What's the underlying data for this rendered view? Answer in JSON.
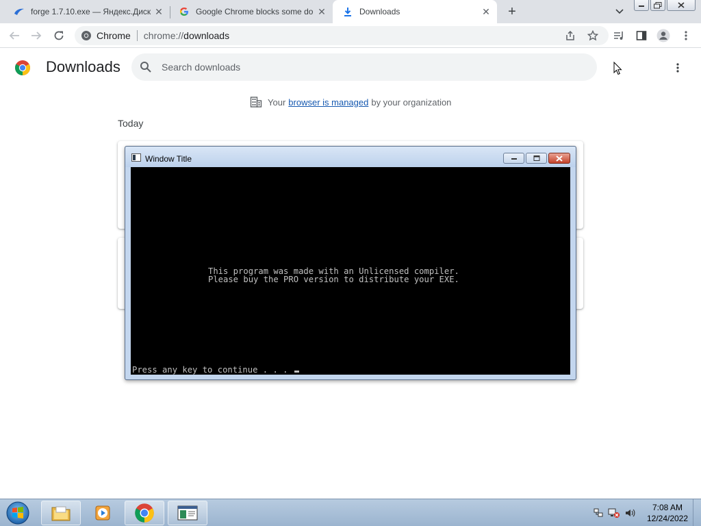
{
  "tabs": [
    {
      "title": "forge 1.7.10.exe — Яндекс.Диск",
      "favicon": "yandex-disk-icon"
    },
    {
      "title": "Google Chrome blocks some do",
      "favicon": "google-icon"
    },
    {
      "title": "Downloads",
      "favicon": "download-icon",
      "active": true
    }
  ],
  "omnibox": {
    "chip": "Chrome",
    "url_scheme": "chrome://",
    "url_host": "downloads"
  },
  "downloads": {
    "title": "Downloads",
    "search_placeholder": "Search downloads",
    "managed_prefix": "Your",
    "managed_link": "browser is managed",
    "managed_suffix": "by your organization",
    "date_header": "Today"
  },
  "console": {
    "window_title": "Window Title",
    "line1": "This program was made with an Unlicensed compiler.",
    "line2": "Please buy the PRO version to distribute your EXE.",
    "prompt": "Press any key to continue . . . "
  },
  "taskbar": {
    "time": "7:08 AM",
    "date": "12/24/2022",
    "apps": [
      "explorer-icon",
      "media-player-icon",
      "chrome-icon",
      "console-app-icon"
    ]
  },
  "colors": {
    "chrome_blue": "#1a73e8",
    "console_bg": "#000000",
    "console_fg": "#c0c0c0"
  }
}
